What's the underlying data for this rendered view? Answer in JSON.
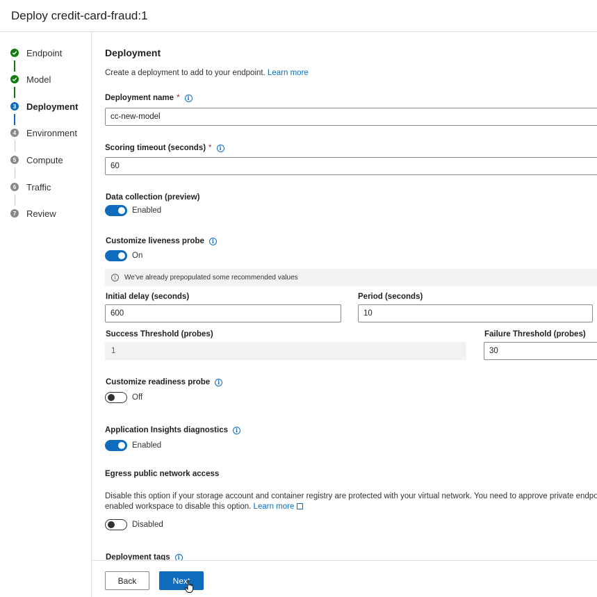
{
  "window": {
    "title": "Deploy credit-card-fraud:1"
  },
  "stepper": [
    {
      "label": "Endpoint",
      "status": "done",
      "number": ""
    },
    {
      "label": "Model",
      "status": "done",
      "number": ""
    },
    {
      "label": "Deployment",
      "status": "active",
      "number": "3"
    },
    {
      "label": "Environment",
      "status": "todo",
      "number": "4"
    },
    {
      "label": "Compute",
      "status": "todo",
      "number": "5"
    },
    {
      "label": "Traffic",
      "status": "todo",
      "number": "6"
    },
    {
      "label": "Review",
      "status": "todo",
      "number": "7"
    }
  ],
  "section": {
    "title": "Deployment",
    "description": "Create a deployment to add to your endpoint.",
    "learn_more": "Learn more"
  },
  "deployment_name": {
    "label": "Deployment name",
    "required": "*",
    "value": "cc-new-model"
  },
  "scoring_timeout": {
    "label": "Scoring timeout (seconds)",
    "required": "*",
    "value": "60"
  },
  "data_collection": {
    "label": "Data collection (preview)",
    "state": "Enabled"
  },
  "liveness": {
    "label": "Customize liveness probe",
    "state": "On",
    "banner": "We've already prepopulated some recommended values",
    "initial_delay": {
      "label": "Initial delay (seconds)",
      "value": "600"
    },
    "period": {
      "label": "Period (seconds)",
      "value": "10"
    },
    "success_threshold": {
      "label": "Success Threshold (probes)",
      "value": "1"
    },
    "failure_threshold": {
      "label": "Failure Threshold (probes)",
      "value": "30"
    }
  },
  "readiness": {
    "label": "Customize readiness probe",
    "state": "Off"
  },
  "app_insights": {
    "label": "Application Insights diagnostics",
    "state": "Enabled"
  },
  "egress": {
    "label": "Egress public network access",
    "line1": "Disable this option if your storage account and container registry are protected with your virtual network. You need to approve private endpoin",
    "line2": "enabled workspace to disable this option.",
    "learn_more": "Learn more",
    "state": "Disabled"
  },
  "tags": {
    "label": "Deployment tags"
  },
  "footer": {
    "back": "Back",
    "next": "Next"
  },
  "colors": {
    "accent": "#0f6cbd",
    "success": "#107c10",
    "neutral": "#8a8886"
  },
  "icons": {
    "check": "check-icon",
    "info": "info-icon",
    "external": "external-link-icon",
    "cursor": "hand-cursor-icon"
  }
}
